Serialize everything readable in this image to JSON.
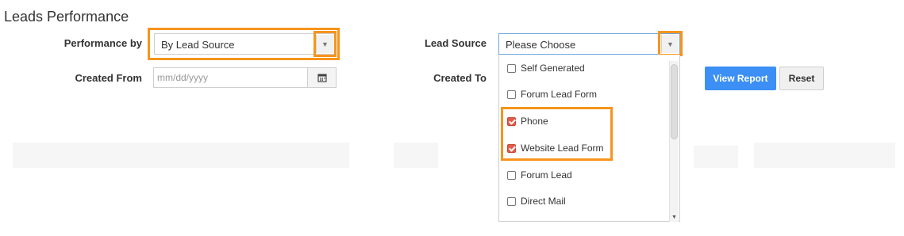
{
  "page_title": "Leads Performance",
  "filters": {
    "performance_by_label": "Performance by",
    "performance_by_value": "By Lead Source",
    "created_from_label": "Created From",
    "created_from_placeholder": "mm/dd/yyyy",
    "lead_source_label": "Lead Source",
    "lead_source_value": "Please Choose",
    "created_to_label": "Created To"
  },
  "lead_source_options": [
    {
      "label": "Self Generated",
      "checked": false
    },
    {
      "label": "Forum Lead Form",
      "checked": false
    },
    {
      "label": "Phone",
      "checked": true
    },
    {
      "label": "Website Lead Form",
      "checked": true
    },
    {
      "label": "Forum Lead",
      "checked": false
    },
    {
      "label": "Direct Mail",
      "checked": false
    }
  ],
  "buttons": {
    "view_report": "View Report",
    "reset": "Reset"
  },
  "colors": {
    "highlight": "#f7941d",
    "primary_button": "#3b8ff5",
    "checkbox_checked": "#e25c4b"
  }
}
